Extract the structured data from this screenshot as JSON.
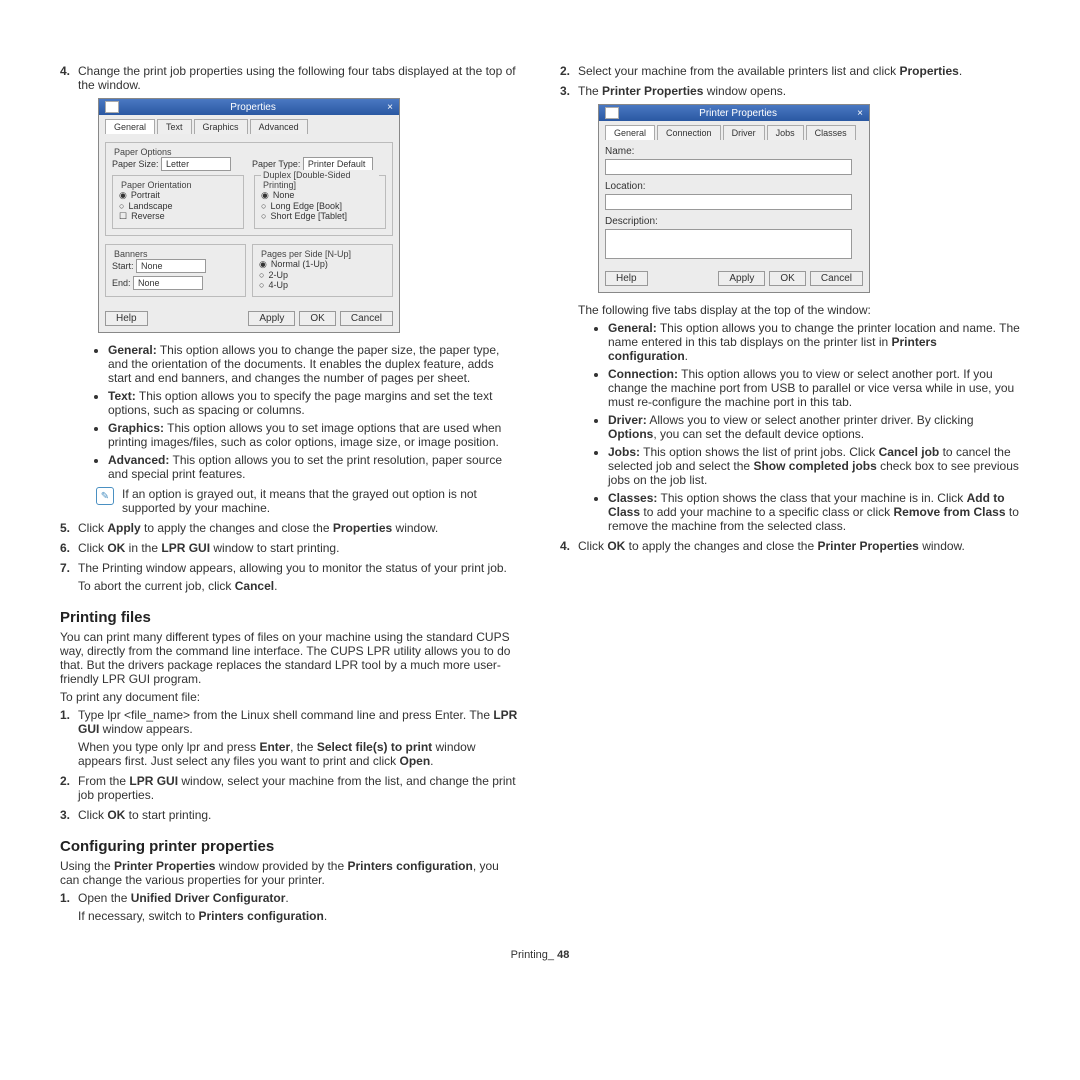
{
  "left": {
    "step4": "Change the print job properties using the following four tabs displayed at the top of the window.",
    "dlg1": {
      "title": "Properties",
      "tabs": [
        "General",
        "Text",
        "Graphics",
        "Advanced"
      ],
      "paper_options_legend": "Paper Options",
      "paper_size_label": "Paper Size:",
      "paper_size_value": "Letter",
      "paper_type_label": "Paper Type:",
      "paper_type_value": "Printer Default",
      "orientation_legend": "Paper Orientation",
      "orient_portrait": "Portrait",
      "orient_landscape": "Landscape",
      "orient_reverse": "Reverse",
      "duplex_legend": "Duplex [Double-Sided Printing]",
      "duplex_none": "None",
      "duplex_long": "Long Edge [Book]",
      "duplex_short": "Short Edge [Tablet]",
      "banners_legend": "Banners",
      "banners_start": "Start:",
      "banners_end": "End:",
      "banners_none": "None",
      "pages_legend": "Pages per Side [N-Up]",
      "pages_normal": "Normal (1-Up)",
      "pages_2": "2-Up",
      "pages_4": "4-Up",
      "help": "Help",
      "apply": "Apply",
      "ok": "OK",
      "cancel": "Cancel"
    },
    "bullets": {
      "general_label": "General:",
      "general_text": "This option allows you to change the paper size, the paper type, and the orientation of the documents. It enables the duplex feature, adds start and end banners, and changes the number of pages per sheet.",
      "text_label": "Text:",
      "text_text": "This option allows you to specify the page margins and set the text options, such as spacing or columns.",
      "graphics_label": "Graphics:",
      "graphics_text": "This option allows you to set image options that are used when printing images/files, such as color options, image size, or image position.",
      "advanced_label": "Advanced:",
      "advanced_text": "This option allows you to set the print resolution, paper source and special print features."
    },
    "note": "If an option is grayed out, it means that the grayed out option is not supported by your machine.",
    "step5_a": "Click ",
    "step5_apply": "Apply",
    "step5_b": " to apply the changes and close the ",
    "step5_props": "Properties",
    "step5_c": " window.",
    "step6_a": "Click ",
    "step6_ok": "OK",
    "step6_b": " in the ",
    "step6_lpr": "LPR GUI",
    "step6_c": " window to start printing.",
    "step7_a": "The Printing window appears, allowing you to monitor the status of your print job.",
    "step7_b": "To abort the current job, click ",
    "step7_cancel": "Cancel",
    "printing_files_h": "Printing files",
    "printing_files_p": "You can print many different types of files on your machine using the standard CUPS way, directly from the command line interface. The CUPS LPR utility allows you to do that. But the drivers package replaces the standard LPR tool by a much more user-friendly LPR GUI program.",
    "printing_files_p2": "To print any document file:",
    "pf_step1_a": "Type lpr <file_name> from the Linux shell command line and press Enter. The ",
    "pf_step1_lpr": "LPR GUI",
    "pf_step1_b": " window appears.",
    "pf_step1_c": "When you type only lpr and press ",
    "pf_step1_enter": "Enter",
    "pf_step1_d": ", the ",
    "pf_step1_select": "Select file(s) to print",
    "pf_step1_e": " window appears first. Just select any files you want to print and click ",
    "pf_step1_open": "Open",
    "pf_step2_a": "From the ",
    "pf_step2_lpr": "LPR GUI",
    "pf_step2_b": " window, select your machine from the list, and change the print job properties.",
    "pf_step3_a": "Click ",
    "pf_step3_ok": "OK",
    "pf_step3_b": " to start printing.",
    "config_h": "Configuring printer properties",
    "config_p_a": "Using the ",
    "config_p_pp": "Printer Properties",
    "config_p_b": " window provided by the ",
    "config_p_pc": "Printers configuration",
    "config_p_c": ", you can change the various properties for your printer.",
    "cfg_step1_a": "Open the ",
    "cfg_step1_udc": "Unified Driver Configurator",
    "cfg_step1_b": "If necessary, switch to ",
    "cfg_step1_pc": "Printers configuration"
  },
  "right": {
    "step2_a": "Select your machine from the available printers list and click ",
    "step2_props": "Properties",
    "step3_a": "The ",
    "step3_pp": "Printer Properties",
    "step3_b": " window opens.",
    "dlg2": {
      "title": "Printer Properties",
      "tabs": [
        "General",
        "Connection",
        "Driver",
        "Jobs",
        "Classes"
      ],
      "name": "Name:",
      "location": "Location:",
      "description": "Description:",
      "help": "Help",
      "apply": "Apply",
      "ok": "OK",
      "cancel": "Cancel"
    },
    "tabs_intro": "The following five tabs display at the top of the window:",
    "b_general_label": "General:",
    "b_general_a": "This option allows you to change the printer location and name. The name entered in this tab displays on the printer list in ",
    "b_general_pc": "Printers configuration",
    "b_conn_label": "Connection:",
    "b_conn_text": "This option allows you to view or select another port. If you change the machine port from USB to parallel or vice versa while in use, you must re-configure the machine port in this tab.",
    "b_driver_label": "Driver:",
    "b_driver_a": "Allows you to view or select another printer driver. By clicking ",
    "b_driver_opt": "Options",
    "b_driver_b": ", you can set the default device options.",
    "b_jobs_label": "Jobs:",
    "b_jobs_a": "This option shows the list of print jobs. Click ",
    "b_jobs_cancel": "Cancel job",
    "b_jobs_b": " to cancel the selected job and select the ",
    "b_jobs_show": "Show completed jobs",
    "b_jobs_c": " check box to see previous jobs on the job list.",
    "b_classes_label": "Classes:",
    "b_classes_a": "This option shows the class that your machine is in. Click ",
    "b_classes_add": "Add to Class",
    "b_classes_b": " to add your machine to a specific class or click ",
    "b_classes_rem": "Remove from Class",
    "b_classes_c": " to remove the machine from the selected class.",
    "step4_a": "Click ",
    "step4_ok": "OK",
    "step4_b": " to apply the changes and close the ",
    "step4_pp": "Printer Properties",
    "step4_c": " window."
  },
  "footer_label": "Printing_",
  "footer_page": "48"
}
